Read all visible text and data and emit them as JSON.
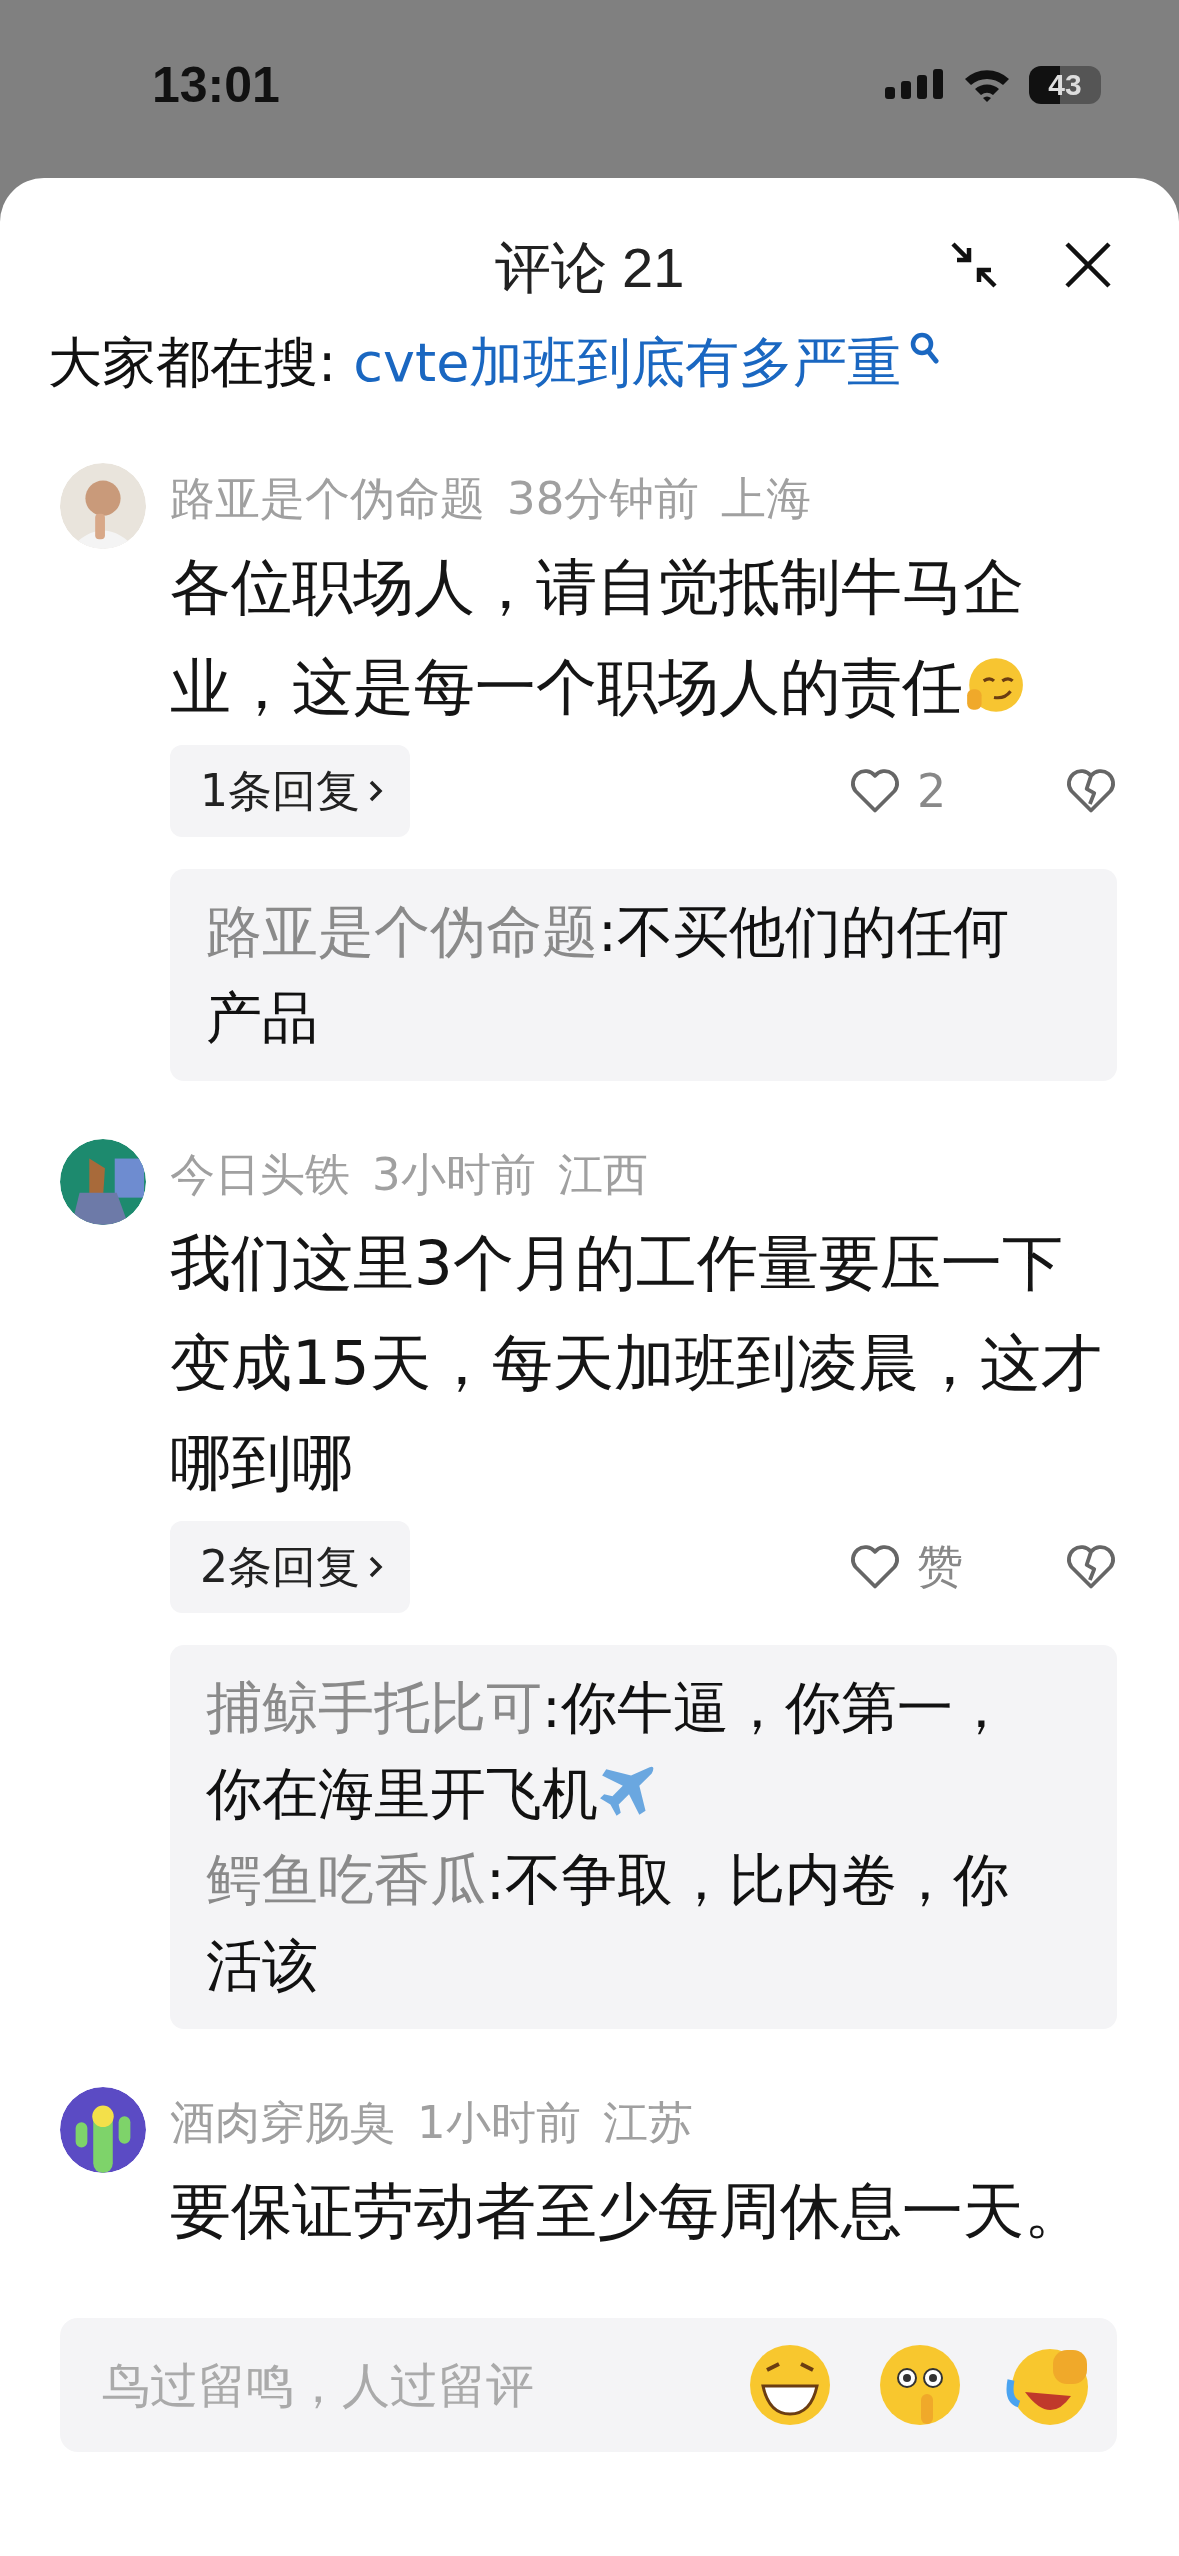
{
  "status_bar": {
    "time": "13:01",
    "battery": "43"
  },
  "header": {
    "title": "评论 21"
  },
  "search_suggestion": {
    "label": "大家都在搜: ",
    "query": "cvte加班到底有多严重"
  },
  "comments": [
    {
      "avatar": {
        "kind": "picture"
      },
      "author": "路亚是个伪命题",
      "time": "38分钟前",
      "location": "上海",
      "text": "各位职场人，请自觉抵制牛马企业，这是每一个职场人的责任",
      "trailing_emoji": true,
      "reply_count": "1条回复",
      "likes": "2",
      "replies": [
        {
          "author": "路亚是个伪命题",
          "text": ":不买他们的任何产品"
        }
      ]
    },
    {
      "avatar": {
        "kind": "picture"
      },
      "author": "今日头铁",
      "time": "3小时前",
      "location": "江西",
      "text": "我们这里3个月的工作量要压一下变成15天，每天加班到凌晨，这才哪到哪",
      "reply_count": "2条回复",
      "likes": "赞",
      "replies": [
        {
          "author": "捕鲸手托比可",
          "text": ":你牛逼，你第一，你在海里开飞机",
          "trailing_emoji": true
        },
        {
          "author": "鳄鱼吃香瓜",
          "text": ":不争取，比内卷，你活该"
        }
      ]
    },
    {
      "avatar": {
        "kind": "picture"
      },
      "author": "酒肉穿肠臭",
      "time": "1小时前",
      "location": "江苏",
      "text": "要保证劳动者至少每周休息一天。"
    }
  ],
  "comment_input": {
    "placeholder": "鸟过留鸣，人过留评",
    "emojis": [
      {
        "kind": "grin"
      },
      {
        "kind": "shush"
      },
      {
        "kind": "laugh"
      }
    ]
  }
}
